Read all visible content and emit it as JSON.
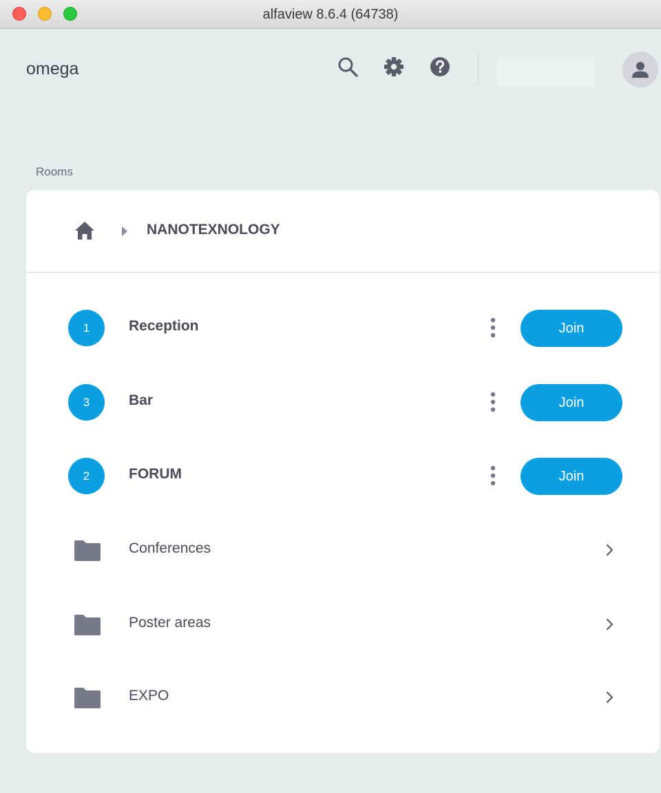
{
  "window": {
    "title": "alfaview 8.6.4 (64738)"
  },
  "header": {
    "workspace_name": "omega",
    "icons": [
      "search-icon",
      "gear-icon",
      "help-icon",
      "person-icon"
    ]
  },
  "rooms": {
    "section_label": "Rooms",
    "breadcrumb": {
      "home_icon": "home-icon",
      "current": "NANOTEXNOLOGY"
    },
    "items": [
      {
        "kind": "room",
        "count": "1",
        "name": "Reception",
        "action_label": "Join"
      },
      {
        "kind": "room",
        "count": "3",
        "name": "Bar",
        "action_label": "Join"
      },
      {
        "kind": "room",
        "count": "2",
        "name": "FORUM",
        "action_label": "Join"
      },
      {
        "kind": "folder",
        "name": "Conferences"
      },
      {
        "kind": "folder",
        "name": "Poster areas"
      },
      {
        "kind": "folder",
        "name": "EXPO"
      }
    ]
  },
  "colors": {
    "accent": "#0a9fe0",
    "background": "#e6ebeb",
    "card": "#ffffff",
    "icon": "#5b5c6a",
    "folder": "#777989"
  }
}
